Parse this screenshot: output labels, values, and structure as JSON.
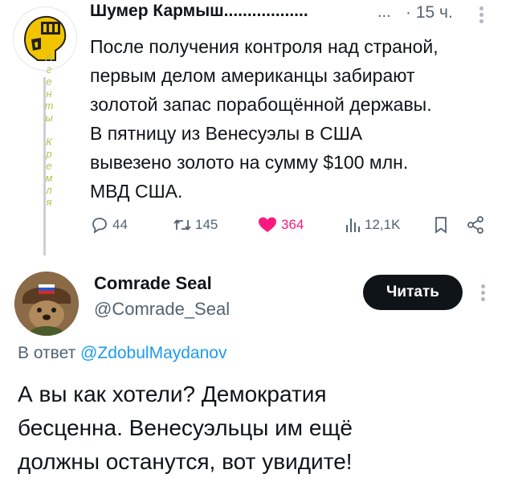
{
  "tweet1": {
    "author_name": "Шумер Кармыш..................",
    "more": "...",
    "time": "· 15 ч.",
    "text": "После получения контроля над страной,\nпервым делом американцы забирают\nзолотой запас порабощённой державы.\nВ пятницу из Венесуэлы в США\nвывезено золото на сумму $100 млн.\nМВД США.",
    "vertical_label": "Агенты Кремля",
    "actions": {
      "replies": "44",
      "reposts": "145",
      "likes": "364",
      "views": "12,1K"
    },
    "icons": [
      "reply-icon",
      "repost-icon",
      "heart-icon",
      "views-icon",
      "bookmark-icon",
      "share-icon"
    ],
    "like_color": "#f91880"
  },
  "tweet2": {
    "author_name": "Comrade Seal",
    "handle": "@Comrade_Seal",
    "follow_label": "Читать",
    "reply_prefix": "В ответ",
    "reply_to": "@ZdobulMaydanov",
    "text": "А вы как хотели? Демократия\nбесценна. Венесуэльцы им ещё\nдолжны останутся, вот увидите!"
  }
}
